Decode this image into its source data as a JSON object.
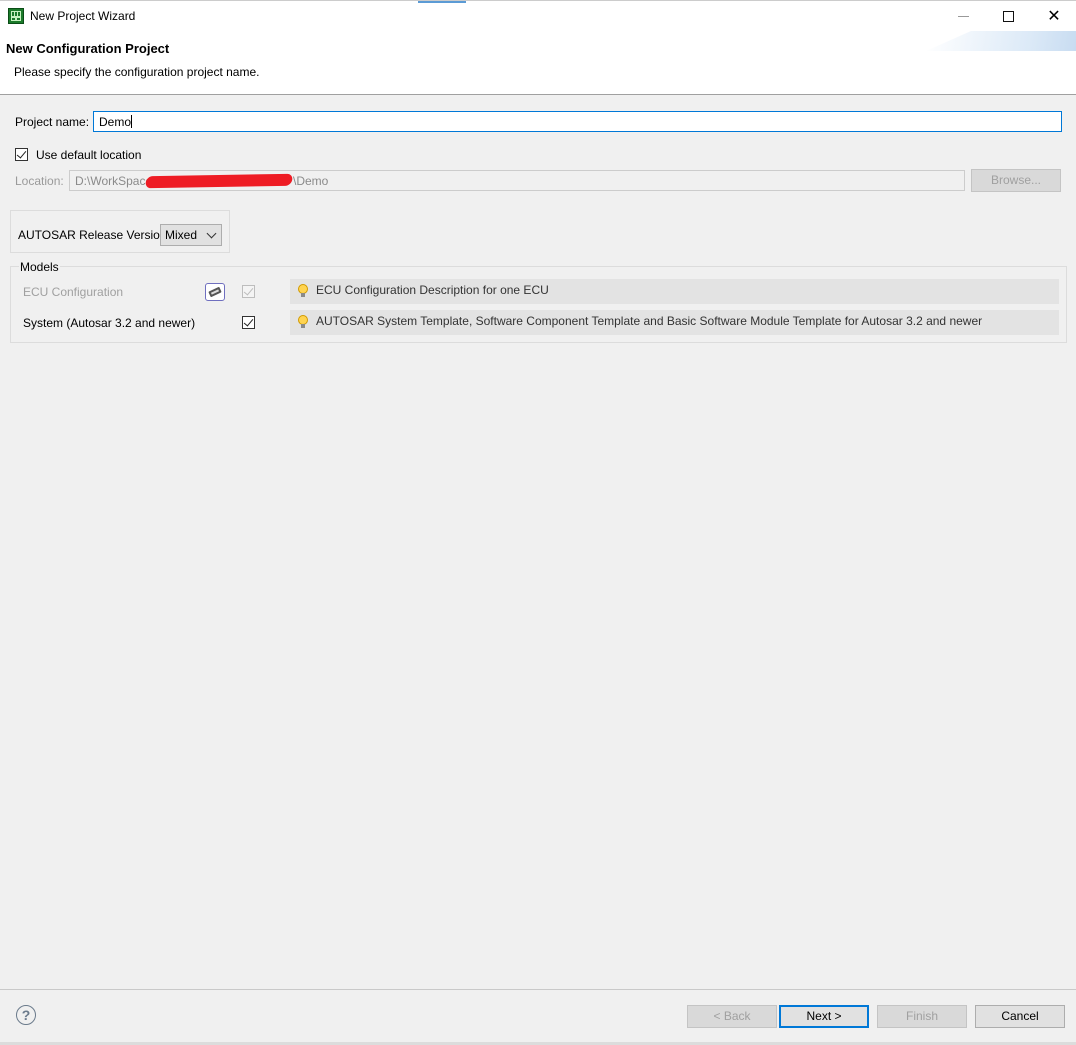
{
  "window": {
    "title": "New Project Wizard",
    "icons": {
      "app": "grid-app-icon",
      "minimize": "minimize-icon",
      "maximize": "maximize-icon",
      "close": "close-icon"
    },
    "close_glyph": "✕"
  },
  "header": {
    "title": "New Configuration Project",
    "subtitle": "Please specify the configuration project name."
  },
  "form": {
    "project_name_label": "Project name:",
    "project_name_value": "Demo",
    "use_default_location_label": "Use default location",
    "use_default_location_checked": true,
    "location_label": "Location:",
    "location_prefix": "D:\\WorkSpace",
    "location_suffix": "\\Demo",
    "browse_label": "Browse...",
    "autosar_label": "AUTOSAR Release Version:",
    "autosar_value": "Mixed"
  },
  "models": {
    "group_label": "Models",
    "items": [
      {
        "name": "ECU Configuration",
        "enabled": false,
        "checked": true,
        "description": "ECU Configuration Description for one ECU",
        "has_tool_icon": true
      },
      {
        "name": "System (Autosar 3.2 and newer)",
        "enabled": true,
        "checked": true,
        "description": "AUTOSAR System Template, Software Component Template and Basic Software Module Template for Autosar 3.2 and newer",
        "has_tool_icon": false
      }
    ]
  },
  "footer": {
    "help_glyph": "?",
    "back_label": "< Back",
    "next_label": "Next >",
    "finish_label": "Finish",
    "cancel_label": "Cancel"
  },
  "colors": {
    "accent": "#0078d7",
    "redaction": "#ee1c24",
    "bulb": "#ffd451"
  }
}
